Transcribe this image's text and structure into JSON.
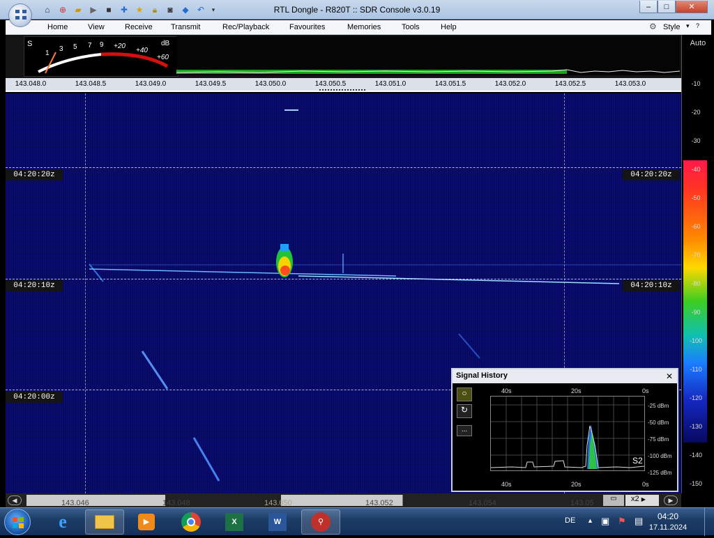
{
  "window": {
    "title": "RTL Dongle - R820T :: SDR Console v3.0.19",
    "minimize": "–",
    "maximize": "□",
    "close": "✕"
  },
  "menu": {
    "items": [
      "Home",
      "View",
      "Receive",
      "Transmit",
      "Rec/Playback",
      "Favourites",
      "Memories",
      "Tools",
      "Help"
    ],
    "style": "Style"
  },
  "smeter": {
    "s": "S",
    "db": "dB",
    "marks": [
      "1",
      "3",
      "5",
      "7",
      "9",
      "+20",
      "+40",
      "+60"
    ]
  },
  "freq_ruler": {
    "labels": [
      "143.048.0",
      "143.048.5",
      "143.049.0",
      "143.049.5",
      "143.050.0",
      "143.050.5",
      "143.051.0",
      "143.051.5",
      "143.052.0",
      "143.052.5",
      "143.053.0"
    ]
  },
  "timestamps": {
    "t1": "04:20:20z",
    "t2": "04:20:10z",
    "t3": "04:20:00z"
  },
  "scale": {
    "auto": "Auto",
    "labels": [
      "-10",
      "-20",
      "-30",
      "-40",
      "-50",
      "-60",
      "-70",
      "-80",
      "-90",
      "-100",
      "-110",
      "-120",
      "-130",
      "-140",
      "-150"
    ]
  },
  "signal_history": {
    "title": "Signal History",
    "close": "✕",
    "top_labels": [
      "40s",
      "20s",
      "0s"
    ],
    "bottom_labels": [
      "40s",
      "20s",
      "0s"
    ],
    "dbm_labels": [
      "-25 dBm",
      "-50 dBm",
      "-75 dBm",
      "-100 dBm",
      "-125 dBm"
    ],
    "s_reading": "S2",
    "dots": "..."
  },
  "bottom_ruler": {
    "labels": [
      "143.046",
      "143.048",
      "143.050",
      "143.052",
      "143.054",
      "143.05"
    ],
    "zoom": "x2"
  },
  "taskbar": {
    "lang": "DE",
    "time": "04:20",
    "date": "17.11.2024"
  },
  "colors": {
    "accent": "#1d3d66",
    "waterfall_bg": "#0b0f66"
  }
}
